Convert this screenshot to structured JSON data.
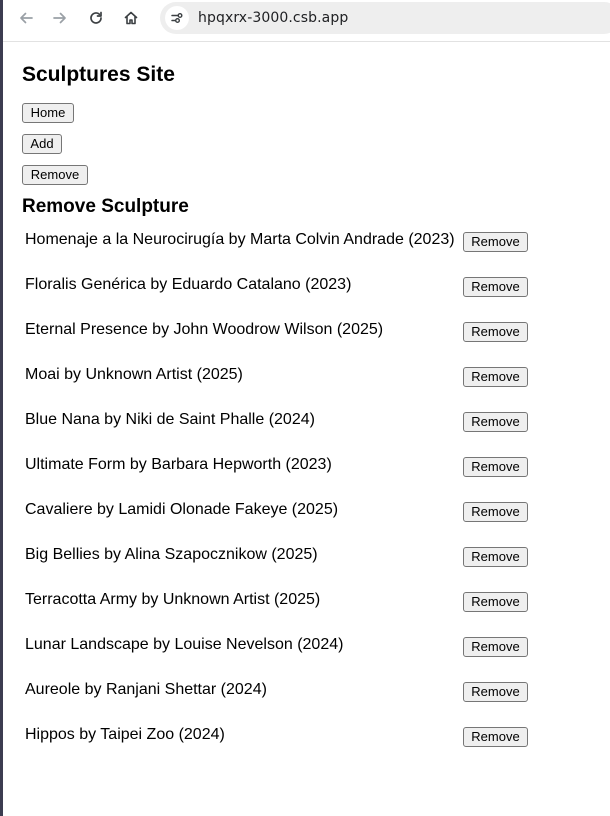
{
  "browser": {
    "url": "hpqxrx-3000.csb.app",
    "icons": [
      "back-arrow-icon",
      "forward-arrow-icon",
      "reload-icon",
      "home-icon",
      "site-info-icon"
    ]
  },
  "page": {
    "site_title": "Sculptures Site",
    "nav": {
      "home": "Home",
      "add": "Add",
      "remove": "Remove"
    },
    "section_title": "Remove Sculpture",
    "remove_label": "Remove",
    "sculptures": [
      "Homenaje a la Neurocirugía by Marta Colvin Andrade (2023)",
      "Floralis Genérica by Eduardo Catalano (2023)",
      "Eternal Presence by John Woodrow Wilson (2025)",
      "Moai by Unknown Artist (2025)",
      "Blue Nana by Niki de Saint Phalle (2024)",
      "Ultimate Form by Barbara Hepworth (2023)",
      "Cavaliere by Lamidi Olonade Fakeye (2025)",
      "Big Bellies by Alina Szapocznikow (2025)",
      "Terracotta Army by Unknown Artist (2025)",
      "Lunar Landscape by Louise Nevelson (2024)",
      "Aureole by Ranjani Shettar (2024)",
      "Hippos by Taipei Zoo (2024)"
    ]
  }
}
